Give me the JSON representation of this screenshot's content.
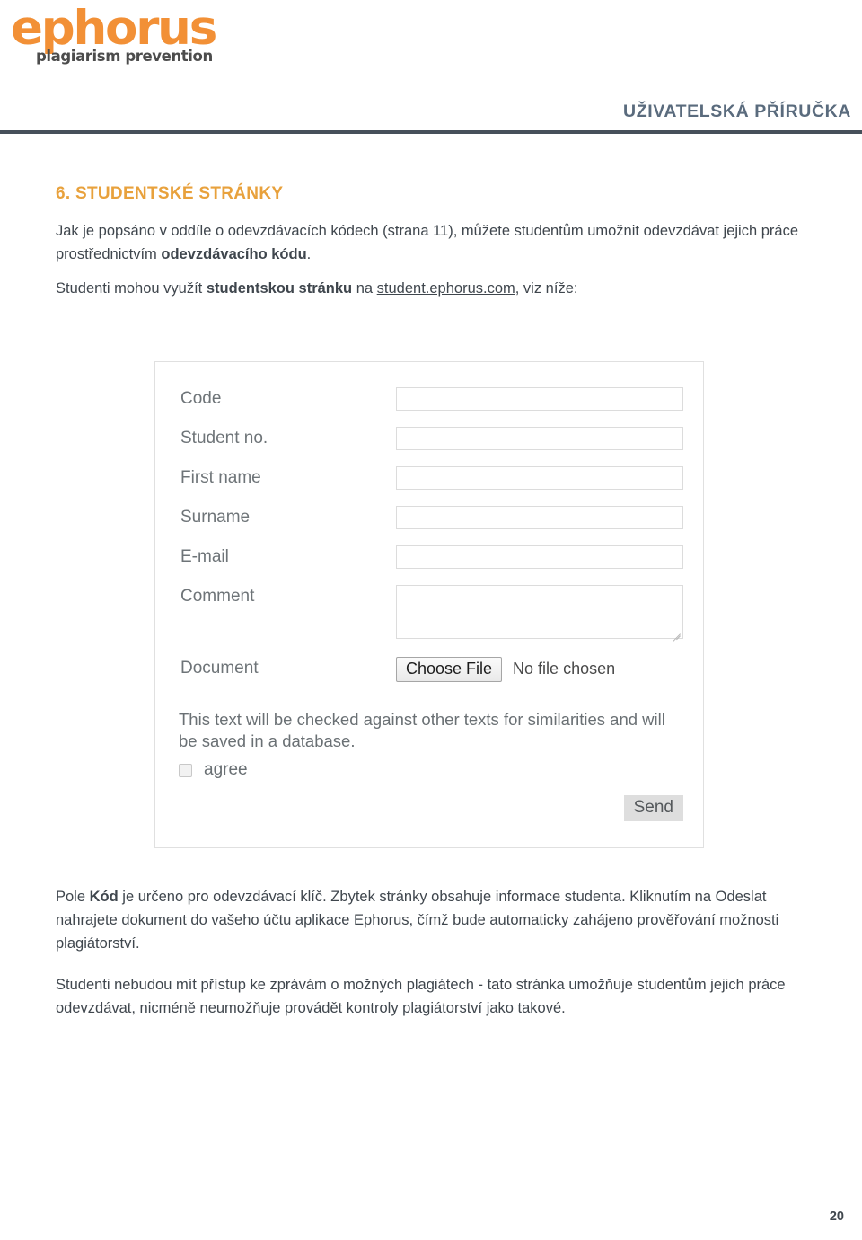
{
  "header": {
    "logo_word": "ephorus",
    "logo_tagline": "plagiarism prevention",
    "title": "UŽIVATELSKÁ PŘÍRUČKA"
  },
  "content": {
    "section_heading": "6. STUDENTSKÉ STRÁNKY",
    "intro_paragraph": {
      "part1": "Jak je popsáno v oddíle o odevzdávacích kódech (strana 11), můžete studentům umožnit odevzdávat jejich práce prostřednictvím ",
      "bold": "odevzdávacího kódu",
      "part2": "."
    },
    "link_paragraph": {
      "part1": "Studenti mohou využít ",
      "bold": "studentskou stránku",
      "part2": " na ",
      "link": "student.ephorus.com",
      "part3": ", viz níže:"
    },
    "explanation_paragraph": {
      "part1": "Pole ",
      "bold": "Kód",
      "part2": " je určeno pro odevzdávací klíč. Zbytek stránky obsahuje informace studenta.  Kliknutím na Odeslat nahrajete dokument do vašeho účtu aplikace Ephorus, čímž bude automaticky zahájeno prověřování možnosti plagiátorství."
    },
    "closing_paragraph": "Studenti nebudou mít přístup ke zprávám o možných plagiátech - tato stránka umožňuje studentům jejich práce odevzdávat, nicméně neumožňuje provádět kontroly plagiátorství jako takové."
  },
  "screenshot_form": {
    "fields": [
      {
        "label": "Code",
        "value": "",
        "type": "text"
      },
      {
        "label": "Student no.",
        "value": "",
        "type": "text"
      },
      {
        "label": "First name",
        "value": "",
        "type": "text"
      },
      {
        "label": "Surname",
        "value": "",
        "type": "text"
      },
      {
        "label": "E-mail",
        "value": "",
        "type": "text"
      },
      {
        "label": "Comment",
        "value": "",
        "type": "textarea"
      }
    ],
    "document_label": "Document",
    "choose_file_label": "Choose File",
    "no_file_text": "No file chosen",
    "consent_text": "This text will be checked against other texts for similarities and will be saved in a database.",
    "agree_label": "agree",
    "agree_checked": false,
    "send_label": "Send"
  },
  "footer": {
    "page_number": "20"
  },
  "colors": {
    "brand_orange": "#f29036",
    "heading_orange": "#e8a13c",
    "header_title_blue": "#5a6b7d",
    "body_text": "#3f464d",
    "rule_dark": "#46505a"
  }
}
